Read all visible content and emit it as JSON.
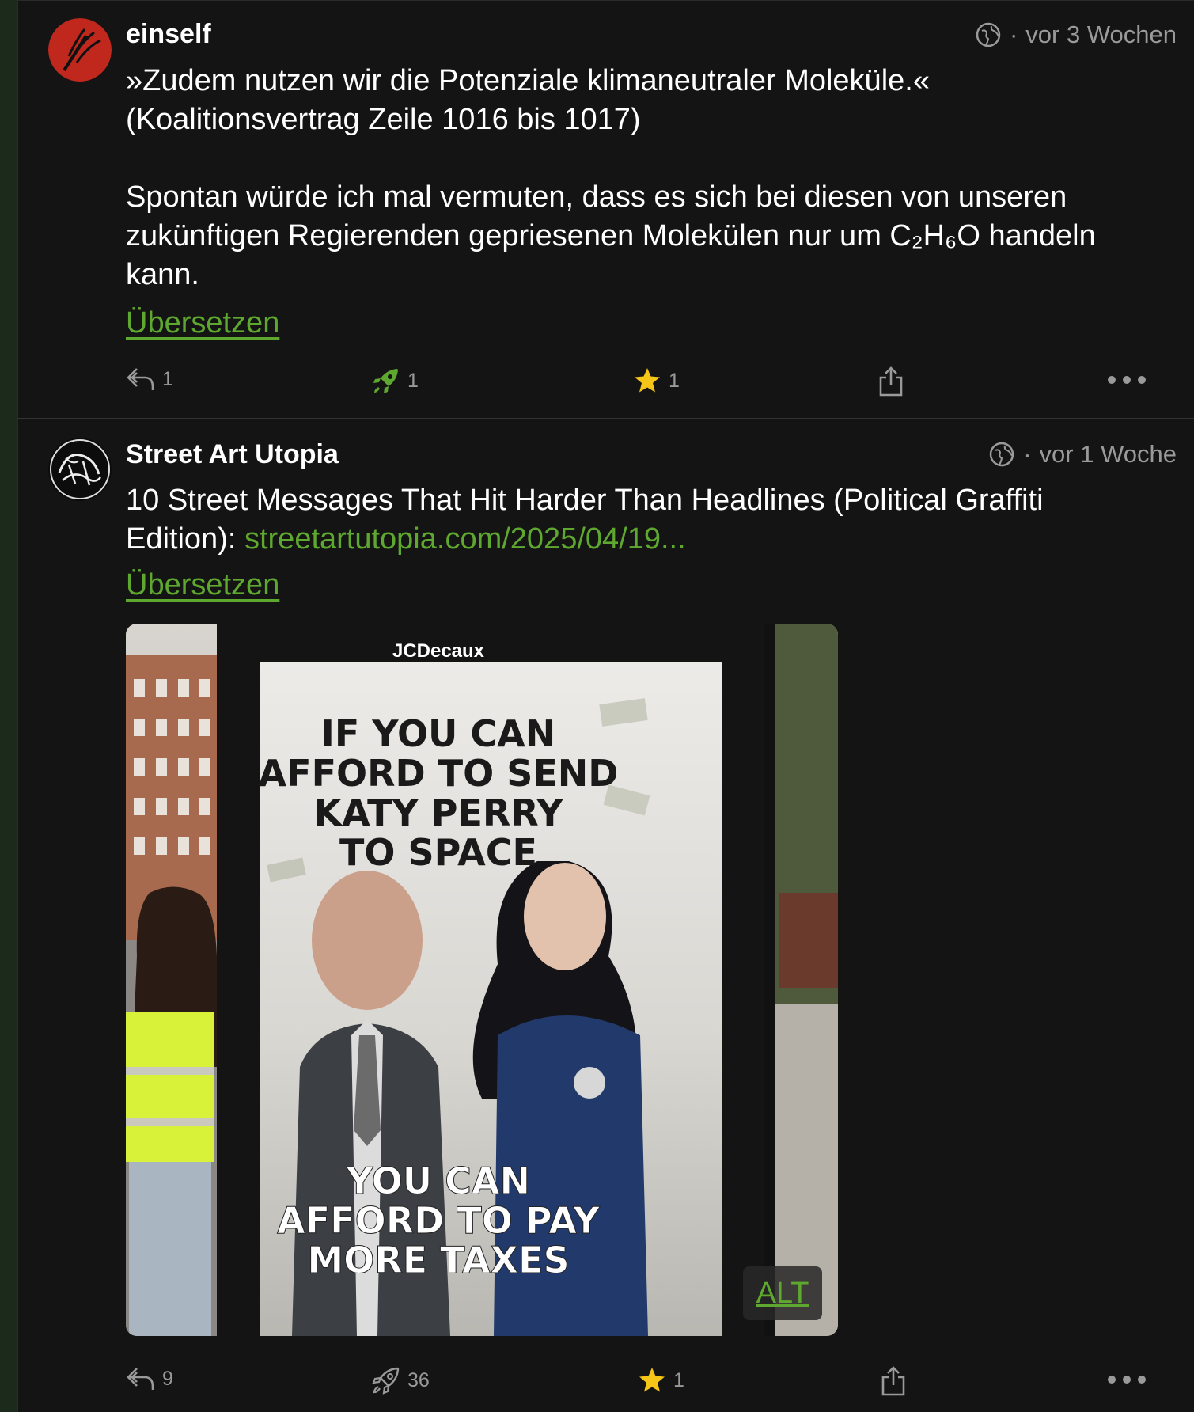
{
  "posts": [
    {
      "author": "einself",
      "time": "vor 3 Wochen",
      "separator": "·",
      "paragraphs": [
        "»Zudem nutzen wir die Potenziale klimaneutraler Moleküle.« (Koalitionsvertrag Zeile 1016 bis 1017)",
        "Spontan würde ich mal vermuten, dass es sich bei diesen von unseren zukünftigen Regierenden gepriesenen Molekülen nur um C₂H₆O handeln kann."
      ],
      "translate_label": "Übersetzen",
      "reply_count": "1",
      "boost_count": "1",
      "favourite_count": "1"
    },
    {
      "author": "Street Art Utopia",
      "time": "vor 1 Woche",
      "separator": "·",
      "text": "10 Street Messages That Hit Harder Than Headlines (Political Graffiti Edition): ",
      "link_text": "streetartutopia.com/2025/04/19...",
      "translate_label": "Übersetzen",
      "image": {
        "brand": "JCDecaux",
        "headline": [
          "IF YOU CAN",
          "AFFORD TO SEND",
          "KATY PERRY",
          "TO SPACE"
        ],
        "tagline": [
          "YOU CAN",
          "AFFORD TO PAY",
          "MORE TAXES"
        ],
        "alt_label": "ALT"
      },
      "reply_count": "9",
      "boost_count": "36",
      "favourite_count": "1"
    }
  ],
  "colors": {
    "background": "#141414",
    "accent_green": "#5fa82f",
    "muted_text": "#9a9a9a",
    "star_yellow": "#f5c518"
  },
  "icons": [
    "globe-icon",
    "reply-icon",
    "boost-icon",
    "star-icon",
    "share-icon",
    "more-icon"
  ]
}
